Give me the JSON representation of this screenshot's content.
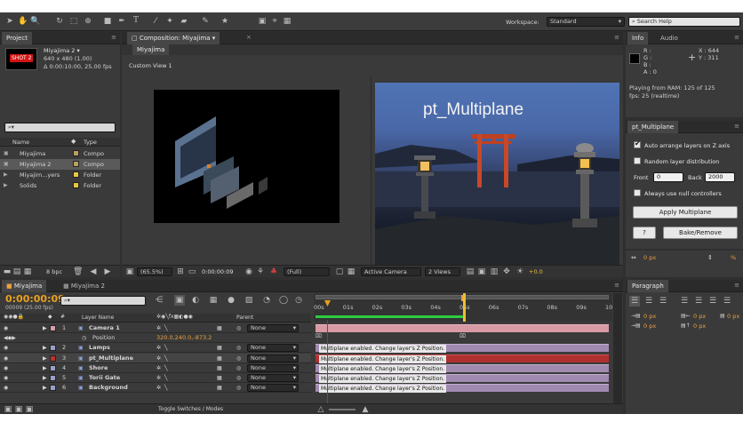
{
  "workspace": {
    "label": "Workspace:",
    "value": "Standard"
  },
  "search_help": {
    "placeholder": "Search Help"
  },
  "project": {
    "tab": "Project",
    "thumb_text": "SHOT 2",
    "comp_name": "Miyajima 2 ▾",
    "comp_size": "640 x 480 (1.00)",
    "comp_dur": "Δ 0:00:10:00, 25.00 fps",
    "col_name": "Name",
    "col_type": "Type",
    "items": [
      {
        "name": "Miyajima",
        "type": "Compo",
        "color": "#b8a060"
      },
      {
        "name": "Miyajima 2",
        "type": "Compo",
        "color": "#b8a060",
        "selected": true
      },
      {
        "name": "Miyajim...yers",
        "type": "Folder",
        "color": "#e8c840"
      },
      {
        "name": "Solids",
        "type": "Folder",
        "color": "#e8c840"
      }
    ],
    "bpc": "8 bpc"
  },
  "composition": {
    "tab": "Composition: Miyajima",
    "subtab": "Miyajima",
    "view_label": "Custom View 1",
    "preview_title": "pt_Multiplane",
    "zoom": "(65.5%)",
    "timecode": "0:00:00:09",
    "resolution": "(Full)",
    "camera": "Active Camera",
    "views": "2 Views",
    "exposure": "+0.0"
  },
  "info": {
    "tab": "Info",
    "tab2": "Audio",
    "r": "R :",
    "g": "G :",
    "b": "B :",
    "a": "A : 0",
    "x": "X : 644",
    "y": "Y : 311",
    "status1": "Playing from RAM: 125 of 125",
    "status2": "fps: 25 (realtime)"
  },
  "multiplane": {
    "tab": "pt_Multiplane",
    "opt_auto": "Auto arrange layers on Z axis",
    "opt_random": "Random layer distribution",
    "front_label": "Front",
    "front_value": "0",
    "back_label": "Back",
    "back_value": "2000",
    "opt_null": "Always use null controllers",
    "apply_button": "Apply Multiplane",
    "help_button": "?",
    "bake_button": "Bake/Remove"
  },
  "character": {
    "px1": "0 px",
    "pct": "%"
  },
  "paragraph": {
    "tab": "Paragraph",
    "v1": "0 px",
    "v2": "0 px",
    "v3": "0 px",
    "v4": "0 px",
    "v5": "0 px"
  },
  "timeline": {
    "tab1": "Miyajima",
    "tab2": "Miyajima 2",
    "timecode": "0:00:00:09",
    "frame_info": "00009 (25.00 fps)",
    "col_layer": "Layer Name",
    "col_parent": "Parent",
    "toggle": "Toggle Switches / Modes",
    "ticks": [
      "00s",
      "01s",
      "02s",
      "03s",
      "04s",
      "05s",
      "06s",
      "07s",
      "08s",
      "09s",
      "10"
    ],
    "message": "Multiplane enabled. Change layer's Z Position.",
    "layers": [
      {
        "num": "1",
        "name": "Camera 1",
        "parent": "None",
        "color": "#d9a0a8"
      },
      {
        "num": "",
        "name": "Position",
        "value": "320.0,240.0,-873.2",
        "parent": "",
        "color": ""
      },
      {
        "num": "2",
        "name": "Lamps",
        "parent": "None",
        "color": "#9aa0c8"
      },
      {
        "num": "3",
        "name": "pt_Multiplane",
        "parent": "None",
        "color": "#c03030"
      },
      {
        "num": "4",
        "name": "Shore",
        "parent": "None",
        "color": "#9aa0c8"
      },
      {
        "num": "5",
        "name": "Torii Gate",
        "parent": "None",
        "color": "#9aa0c8"
      },
      {
        "num": "6",
        "name": "Background",
        "parent": "None",
        "color": "#9aa0c8"
      }
    ]
  }
}
